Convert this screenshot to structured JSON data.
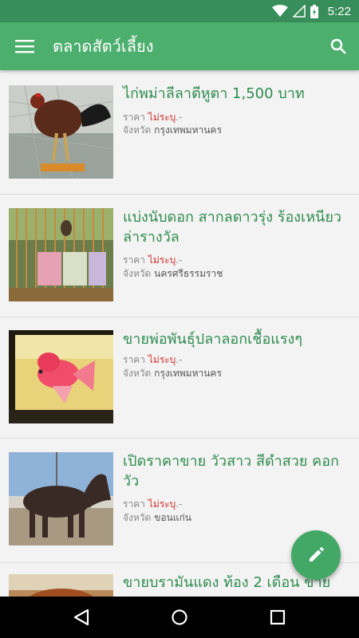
{
  "status_bar": {
    "time": "5:22",
    "icons": [
      "wifi-icon",
      "signal-icon",
      "battery-charging-icon"
    ]
  },
  "app_bar": {
    "title": "ตลาดสัตว์เลี้ยง",
    "menu_icon": "menu-icon",
    "search_icon": "search-icon"
  },
  "listings": [
    {
      "title": "ไก่พม่าลีลาตีหูตา 1,500 บาท",
      "price_label": "ราคา",
      "price_value": "ไม่ระบุ",
      "price_suffix": ".-",
      "province_label": "จังหวัด",
      "province": "กรุงเทพมหานคร"
    },
    {
      "title": "แบ่งนับดอก สากลดาวรุ่ง ร้องเหนียว ล่ารางวัล",
      "price_label": "ราคา",
      "price_value": "ไม่ระบุ",
      "price_suffix": ".-",
      "province_label": "จังหวัด",
      "province": "นครศรีธรรมราช"
    },
    {
      "title": "ขายพ่อพันธุ์ปลาลอกเชื้อแรงๆ",
      "price_label": "ราคา",
      "price_value": "ไม่ระบุ",
      "price_suffix": ".-",
      "province_label": "จังหวัด",
      "province": "กรุงเทพมหานคร"
    },
    {
      "title": "เปิดราคาขาย วัวสาว สีดำสวย คอกวัว",
      "price_label": "ราคา",
      "price_value": "ไม่ระบุ",
      "price_suffix": ".-",
      "province_label": "จังหวัด",
      "province": "ขอนแก่น"
    },
    {
      "title": "ขายบรามันแดง ท้อง 2 เดือน ขาย"
    }
  ],
  "fab": {
    "icon": "edit-pencil-icon"
  },
  "nav_bar": {
    "icons": [
      "back-icon",
      "home-icon",
      "recents-icon"
    ]
  },
  "colors": {
    "primary": "#4caf6e",
    "primary_dark": "#388e5a",
    "accent": "#43a866",
    "title_text": "#2e8b4e",
    "price_text": "#d32f2f"
  }
}
